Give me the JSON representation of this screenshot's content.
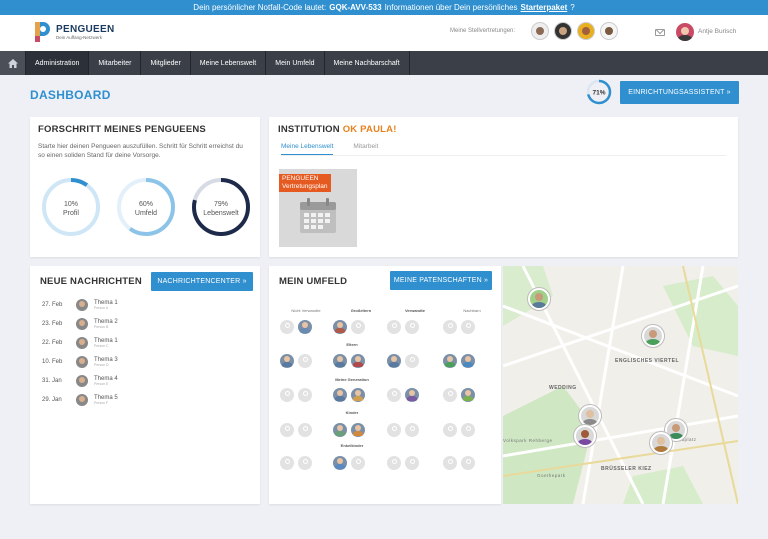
{
  "banner": {
    "prefix": "Dein persönlicher Notfall-Code lautet:",
    "code": "GQK-AVV-533",
    "middle": "Informationen über Dein persönliches",
    "link": "Starterpaket",
    "suffix": "?"
  },
  "header": {
    "logo_name": "PENGUEEN",
    "logo_sub": "Dein Auffang-Netzwerk",
    "stellvertreter_label": "Meine Stellvertretungen:",
    "user_name": "Antje Burisch"
  },
  "nav": {
    "items": [
      "Administration",
      "Mitarbeiter",
      "Mitglieder",
      "Meine Lebenswelt",
      "Mein Umfeld",
      "Meine Nachbarschaft"
    ]
  },
  "dashboard": {
    "title": "DASHBOARD",
    "progress_label": "71%",
    "progress_value": 0.71,
    "assistant_button": "EINRICHTUNGSASSISTENT »"
  },
  "fortschritt": {
    "title": "FORSCHRITT MEINES PENGUEENS",
    "intro": "Starte hier deinen Pengueen auszufüllen. Schritt für Schritt erreichst du so einen soliden Stand für deine Vorsorge.",
    "donuts": [
      {
        "pct": "10%",
        "label": "Profil",
        "value": 0.1,
        "color": "#2f8fcf"
      },
      {
        "pct": "60%",
        "label": "Umfeld",
        "value": 0.6,
        "color": "#8cc3e8"
      },
      {
        "pct": "79%",
        "label": "Lebenswelt",
        "value": 0.79,
        "color": "#1e2a4a"
      }
    ]
  },
  "institution": {
    "title": "INSTITUTION",
    "name": "OK PAULA!",
    "tabs": [
      "Meine Lebenswelt",
      "Mitarbeit"
    ],
    "tile_label_1": "PENGUEEN",
    "tile_label_2": "Vertretungsplan"
  },
  "nachrichten": {
    "title": "NEUE NACHRICHTEN",
    "button": "NACHRICHTENCENTER »",
    "items": [
      {
        "date": "27. Feb",
        "title": "Thema 1",
        "sub": "Person A"
      },
      {
        "date": "23. Feb",
        "title": "Thema 2",
        "sub": "Person B"
      },
      {
        "date": "22. Feb",
        "title": "Thema 1",
        "sub": "Person C"
      },
      {
        "date": "10. Feb",
        "title": "Thema 3",
        "sub": "Person D"
      },
      {
        "date": "31. Jan",
        "title": "Thema 4",
        "sub": "Person E"
      },
      {
        "date": "29. Jan",
        "title": "Thema 5",
        "sub": "Person F"
      }
    ]
  },
  "umfeld": {
    "title": "MEIN UMFELD",
    "button": "MEINE PATENSCHAFTEN »",
    "columns": [
      "Nicht Verwandte",
      "Großeltern",
      "Verwandte",
      "Nachbarn"
    ],
    "groups": [
      "Eltern",
      "Meine Generation",
      "Kinder",
      "Enkelkinder"
    ]
  },
  "map": {
    "labels": [
      "ENGLISCHES VIERTEL",
      "WEDDING",
      "BRÜSSELER KIEZ",
      "Leopoldplatz",
      "Goethepark",
      "Volkspark Rehberge"
    ]
  }
}
